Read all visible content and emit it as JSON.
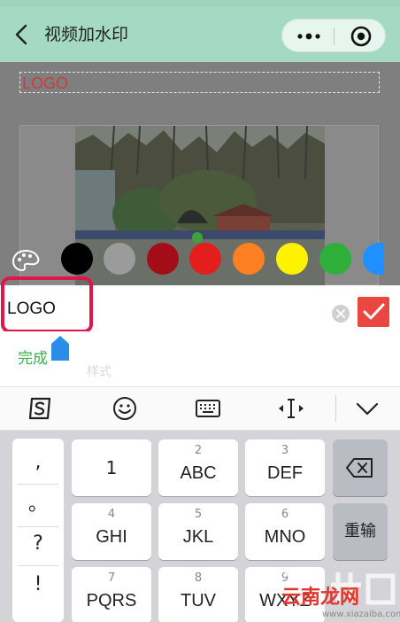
{
  "navbar": {
    "title": "视频加水印",
    "back_icon": "chevron-left-icon",
    "more_icon": "more-dots-icon",
    "close_icon": "target-circle-icon"
  },
  "preview": {
    "watermark_text": "LOGO",
    "watermark_color": "#d23a3a"
  },
  "palette": {
    "icon": "palette-icon",
    "colors": [
      "#000000",
      "#9b9b9b",
      "#a30d17",
      "#e41d1d",
      "#ff7f23",
      "#fff200",
      "#2fae3a",
      "#1e90ff"
    ]
  },
  "input": {
    "value": "LOGO",
    "clear_icon": "clear-x-icon",
    "confirm_icon": "checkmark-icon",
    "confirm_color": "#e9473f"
  },
  "done_row": {
    "done_label": "完成",
    "style_hint": "样式"
  },
  "keyboard_toolbar": {
    "icons": [
      "sogou-s-icon",
      "emoji-icon",
      "keyboard-icon",
      "cursor-move-icon",
      "collapse-chevron-icon"
    ]
  },
  "keyboard": {
    "punctuation": [
      ",",
      "。",
      "?",
      "!"
    ],
    "keys": [
      {
        "num": "",
        "label": "1"
      },
      {
        "num": "2",
        "label": "ABC"
      },
      {
        "num": "3",
        "label": "DEF"
      },
      {
        "num": "4",
        "label": "GHI"
      },
      {
        "num": "5",
        "label": "JKL"
      },
      {
        "num": "6",
        "label": "MNO"
      },
      {
        "num": "7",
        "label": "PQRS"
      },
      {
        "num": "8",
        "label": "TUV"
      },
      {
        "num": "9",
        "label": "WXYZ"
      }
    ],
    "backspace_icon": "backspace-icon",
    "reinput_label": "重输"
  },
  "site_watermark": {
    "name": "云南龙网",
    "url": "www.xiazaiba.com"
  }
}
